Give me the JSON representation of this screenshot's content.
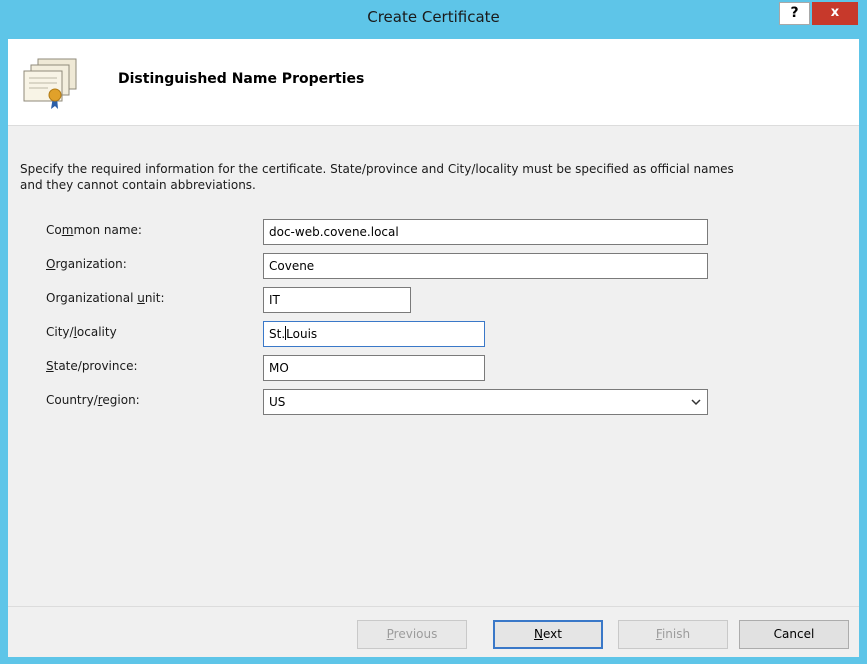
{
  "window": {
    "title": "Create Certificate",
    "help_label": "?",
    "close_label": "x"
  },
  "header": {
    "title": "Distinguished Name Properties",
    "icon": "certificate-icon"
  },
  "description": "Specify the required information for the certificate. State/province and City/locality must be specified as official names and they cannot contain abbreviations.",
  "fields": {
    "common_name": {
      "label_pre": "Co",
      "label_acc": "m",
      "label_post": "mon name:",
      "value": "doc-web.covene.local"
    },
    "organization": {
      "label_pre": "",
      "label_acc": "O",
      "label_post": "rganization:",
      "value": "Covene"
    },
    "org_unit": {
      "label_pre": "Organizational ",
      "label_acc": "u",
      "label_post": "nit:",
      "value": "IT"
    },
    "city": {
      "label_pre": "City/",
      "label_acc": "l",
      "label_post": "ocality",
      "value_before_caret": "St.",
      "value_after_caret": "Louis"
    },
    "state": {
      "label_pre": "",
      "label_acc": "S",
      "label_post": "tate/province:",
      "value": "MO"
    },
    "country": {
      "label_pre": "Country/",
      "label_acc": "r",
      "label_post": "egion:",
      "value": "US"
    }
  },
  "buttons": {
    "previous": {
      "pre": "",
      "acc": "P",
      "post": "revious"
    },
    "next": {
      "pre": "",
      "acc": "N",
      "post": "ext"
    },
    "finish": {
      "pre": "",
      "acc": "F",
      "post": "inish"
    },
    "cancel": "Cancel"
  },
  "colors": {
    "titlebar": "#5ec5e8",
    "close": "#c7392b",
    "focus": "#3a78c8"
  }
}
